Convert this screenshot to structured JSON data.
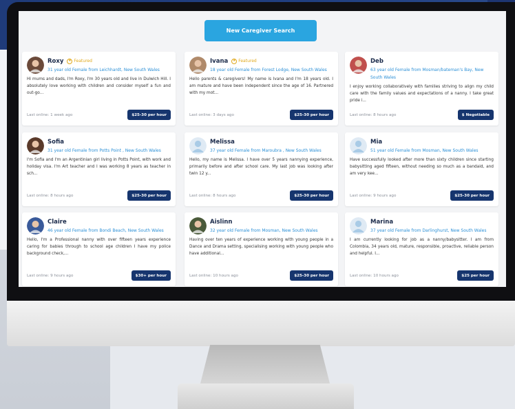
{
  "search_button": "New Caregiver Search",
  "cards": [
    {
      "name": "Roxy",
      "featured": "Featured",
      "avatar": "photo",
      "avatar_color": "#6b4a3a",
      "subtitle": "31 year old Female from Leichhardt, New South Wales",
      "bio": "Hi mums and dads, I'm Roxy, I'm 30 years old and live in Dulwich Hill. I absolutely love working with children and consider myself a fun and out-go...",
      "last_online": "Last online: 1 week ago",
      "rate": "$25-30 per hour"
    },
    {
      "name": "Ivana",
      "featured": "Featured",
      "avatar": "photo",
      "avatar_color": "#b08a6a",
      "subtitle": "18 year old Female from Forest Lodge, New South Wales",
      "bio": "Hello parents & caregivers! My name is Ivana and I'm 18 years old. I am mature and have been independent since the age of 16. Partnered with my mot...",
      "last_online": "Last online: 3 days ago",
      "rate": "$25-30 per hour"
    },
    {
      "name": "Deb",
      "featured": "",
      "avatar": "photo",
      "avatar_color": "#c0504d",
      "subtitle": "63 year old Female from Mosman/bateman's Bay, New South Wales",
      "bio": "I enjoy working collaboratively with families striving to align my child care with the family values and expectations of a nanny. I take great pride i...",
      "last_online": "Last online: 8 hours ago",
      "rate": "$ Negotiable"
    },
    {
      "name": "Sofia",
      "featured": "",
      "avatar": "photo",
      "avatar_color": "#5a3a2a",
      "subtitle": "31 year old Female from Potts Point , New South Wales",
      "bio": "I'm Sofia and I'm an Argentinian girl living in Potts Point, with work and holiday visa. I'm Art teacher and I was working 8 years as teacher in sch...",
      "last_online": "Last online: 8 hours ago",
      "rate": "$25-30 per hour"
    },
    {
      "name": "Melissa",
      "featured": "",
      "avatar": "placeholder",
      "avatar_color": "#a9cbe6",
      "subtitle": "37 year old Female from Maroubra , New South Wales",
      "bio": "Hello, my name is Melissa. I have over 5 years nannying experience, primarily before and after school care. My last job was looking after twin 12 y...",
      "last_online": "Last online: 8 hours ago",
      "rate": "$25-30 per hour"
    },
    {
      "name": "Mia",
      "featured": "",
      "avatar": "placeholder",
      "avatar_color": "#a9cbe6",
      "subtitle": "51 year old Female from Mosman, New South Wales",
      "bio": "Have successfully looked after more than sixty children since starting babysitting aged fifteen, without needing so much as a bandaid, and am very kee...",
      "last_online": "Last online: 9 hours ago",
      "rate": "$25-30 per hour"
    },
    {
      "name": "Claire",
      "featured": "",
      "avatar": "photo",
      "avatar_color": "#3a5a9a",
      "subtitle": "46 year old Female from Bondi Beach, New South Wales",
      "bio": "Hello, I'm a Professional nanny with over fifteen years experience caring for babies through to school age children I have my police background check,...",
      "last_online": "Last online: 9 hours ago",
      "rate": "$30+ per hour"
    },
    {
      "name": "Aislinn",
      "featured": "",
      "avatar": "photo",
      "avatar_color": "#4a5a3a",
      "subtitle": "32 year old Female from Mosman, New South Wales",
      "bio": "Having over ten years of experience working with young people in a Dance and Drama setting, specialising working with young people who have additional...",
      "last_online": "Last online: 10 hours ago",
      "rate": "$25-30 per hour"
    },
    {
      "name": "Marina",
      "featured": "",
      "avatar": "placeholder",
      "avatar_color": "#a9cbe6",
      "subtitle": "37 year old Female from Darlinghurst, New South Wales",
      "bio": "I am currently looking for job as a nanny/babysitter. I am from Colombia, 34 years old, mature, responsible, proactive, reliable person and helpful. I...",
      "last_online": "Last online: 10 hours ago",
      "rate": "$25 per hour"
    }
  ]
}
